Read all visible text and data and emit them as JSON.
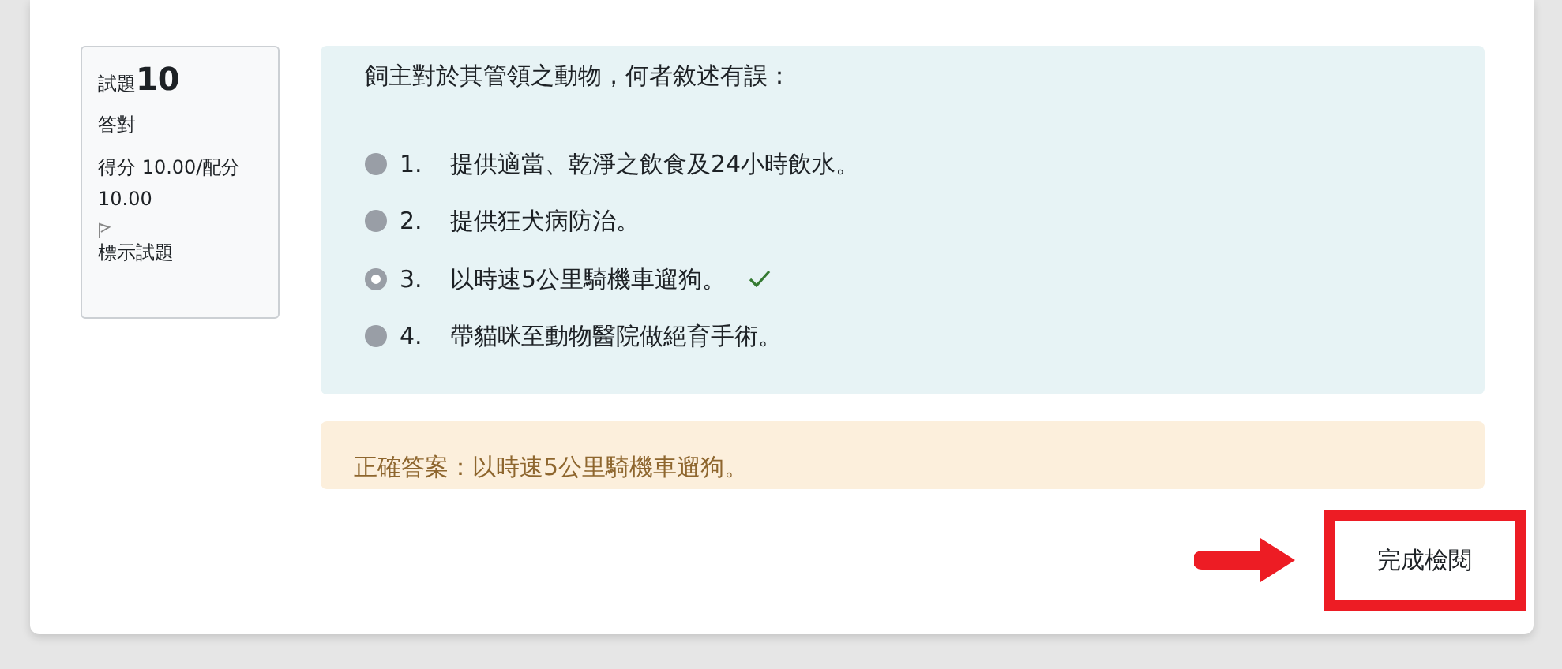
{
  "question_info": {
    "label": "試題",
    "number": "10",
    "status": "答對",
    "grade": "得分 10.00/配分 10.00",
    "flag_label": "標示試題"
  },
  "question": {
    "text": "飼主對於其管領之動物，何者敘述有誤：",
    "options": [
      {
        "number": "1.",
        "text": "提供適當、乾淨之飲食及24小時飲水。",
        "selected": false,
        "correct": false
      },
      {
        "number": "2.",
        "text": "提供狂犬病防治。",
        "selected": false,
        "correct": false
      },
      {
        "number": "3.",
        "text": "以時速5公里騎機車遛狗。",
        "selected": true,
        "correct": true
      },
      {
        "number": "4.",
        "text": "帶貓咪至動物醫院做絕育手術。",
        "selected": false,
        "correct": false
      }
    ]
  },
  "feedback": {
    "text": "正確答案：以時速5公里騎機車遛狗。"
  },
  "finish_button": {
    "label": "完成檢閱"
  }
}
